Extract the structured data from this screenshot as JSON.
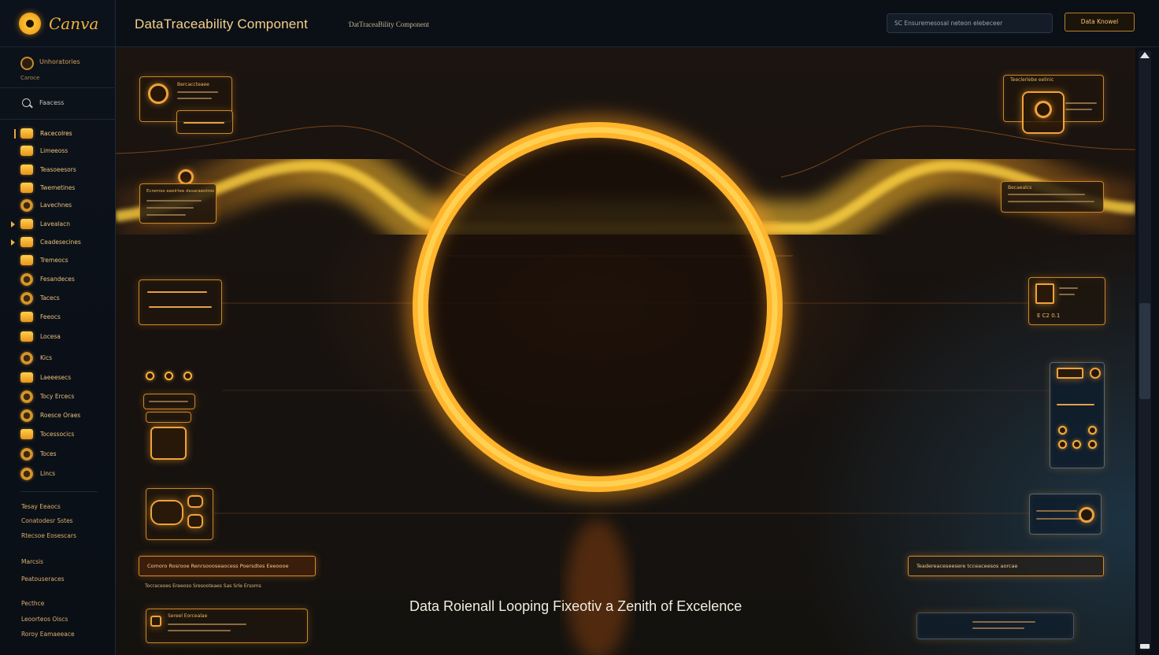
{
  "app": {
    "name": "Canva"
  },
  "header": {
    "title": "DataTraceability Component",
    "breadcrumb": "DatTraceaBility Component",
    "search_value": "SC  Ensuremesosal neteon elebeceer",
    "button_label": "Data Knowel"
  },
  "sidebar": {
    "account_label": "Unhoratories",
    "account_sub": "Caroce",
    "search_label": "Faacess",
    "nav_items": [
      {
        "label": "Racecolres",
        "icon": "warning-icon",
        "active": true
      },
      {
        "label": "Limeeoss",
        "icon": "folder-icon"
      },
      {
        "label": "Teasoeesors",
        "icon": "folder-icon"
      },
      {
        "label": "Twemetines",
        "icon": "folder-icon"
      },
      {
        "label": "Lavechnes",
        "icon": "database-icon"
      },
      {
        "label": "Lavealacn",
        "icon": "folder-icon",
        "caret": true
      },
      {
        "label": "Ceadesecines",
        "icon": "folder-icon",
        "caret": true
      },
      {
        "label": "Tremeocs",
        "icon": "document-icon"
      },
      {
        "label": "Fesandeces",
        "icon": "shield-icon"
      },
      {
        "label": "Tacecs",
        "icon": "info-icon"
      },
      {
        "label": "Feeocs",
        "icon": "folder-icon"
      },
      {
        "label": "Locesa",
        "icon": "folder-icon"
      },
      {
        "label": "Kics",
        "icon": "clock-icon"
      },
      {
        "label": "Laeeesecs",
        "icon": "folder-icon"
      },
      {
        "label": "Tocy Ercecs",
        "icon": "chart-icon"
      },
      {
        "label": "Roesce Oraes",
        "icon": "globe-icon"
      },
      {
        "label": "Tocessocics",
        "icon": "lock-icon"
      },
      {
        "label": "Toces",
        "icon": "layers-icon"
      },
      {
        "label": "Lincs",
        "icon": "user-icon"
      }
    ],
    "links_1": [
      "Tesay Eeaocs",
      "Conatodesr Sstes",
      "Rtecsoe Eosescars"
    ],
    "links_2": [
      "Marcsis",
      "Peatouseraces"
    ],
    "links_3": [
      "Pecthce",
      "Leoorteos Oiscs",
      "Roroy Eamaeeace"
    ]
  },
  "canvas": {
    "caption": "Data Roienall Looping Fixeotiv a Zenith of Excelence",
    "cards": {
      "top_left_title": "Bercaccteaee",
      "mid_left_title": "Ecremes eeelrtee desaraeotros",
      "right_top_title": "Teeclerlebe eelinic",
      "right_mid_title": "Becaealcs",
      "right_box_label": "E C2 0.1",
      "bottom_left_bar": "Comoro  Rosrooe  Renrsoooseaocess  Poersdtes  Eeeoooe",
      "bottom_left_sub": "Tocraceoes  Ereeoso  Sresooteaes  Sas  Srle  Ersoms",
      "bottom_right_bar": "Teadereaceseesere tcceaceesos aorcae",
      "bottom_left_small": "Sereel Eorcealae"
    }
  },
  "colors": {
    "accent": "#f0a23a",
    "glow": "#ffd23a",
    "background": "#17120f"
  }
}
